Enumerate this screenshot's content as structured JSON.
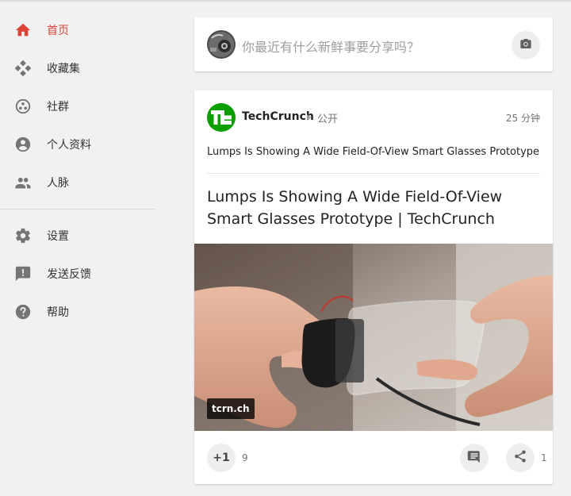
{
  "colors": {
    "accent": "#db4437",
    "icon": "#757575",
    "background": "#f1f1f1",
    "card": "#ffffff",
    "techcrunch_green": "#0a9e01"
  },
  "sidebar": {
    "items": [
      {
        "label": "首页",
        "icon": "home-icon",
        "active": true
      },
      {
        "label": "收藏集",
        "icon": "collections-icon"
      },
      {
        "label": "社群",
        "icon": "communities-icon"
      },
      {
        "label": "个人资料",
        "icon": "profile-icon"
      },
      {
        "label": "人脉",
        "icon": "people-icon"
      }
    ],
    "secondary": [
      {
        "label": "设置",
        "icon": "gear-icon"
      },
      {
        "label": "发送反馈",
        "icon": "feedback-icon"
      },
      {
        "label": "帮助",
        "icon": "help-icon"
      }
    ]
  },
  "share_box": {
    "placeholder": "你最近有什么新鲜事要分享吗？",
    "camera_icon": "camera-icon"
  },
  "post": {
    "author": "TechCrunch",
    "visibility": "公开",
    "time": "25 分钟",
    "text": "Lumps Is Showing A Wide Field-Of-View Smart Glasses Prototype",
    "link_title": "Lumps Is Showing A Wide Field-Of-View Smart Glasses Prototype | TechCrunch",
    "domain": "tcrn.ch",
    "plus_label": "+1",
    "plus_count": "9",
    "share_count": "1"
  }
}
